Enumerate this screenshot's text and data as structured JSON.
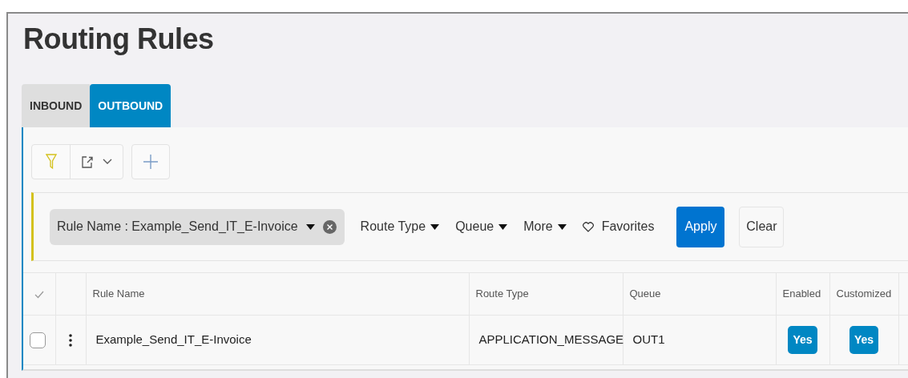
{
  "page": {
    "title": "Routing Rules"
  },
  "tabs": [
    {
      "label": "INBOUND",
      "selected": false
    },
    {
      "label": "OUTBOUND",
      "selected": true
    }
  ],
  "filter_bar": {
    "active_filter": "Rule Name : Example_Send_IT_E-Invoice",
    "dropdowns": [
      "Route Type",
      "Queue",
      "More"
    ],
    "favorites": "Favorites",
    "buttons": [
      {
        "label": "Apply",
        "kind": "primary"
      },
      {
        "label": "Clear",
        "kind": "secondary"
      }
    ]
  },
  "table": {
    "columns": [
      "Rule Name",
      "Route Type",
      "Queue",
      "Enabled",
      "Customized"
    ],
    "rows": [
      {
        "checked": false,
        "cells": [
          "Example_Send_IT_E-Invoice",
          "APPLICATION_MESSAGE",
          "OUT1"
        ],
        "flags": [
          "Yes",
          "Yes"
        ]
      }
    ]
  }
}
